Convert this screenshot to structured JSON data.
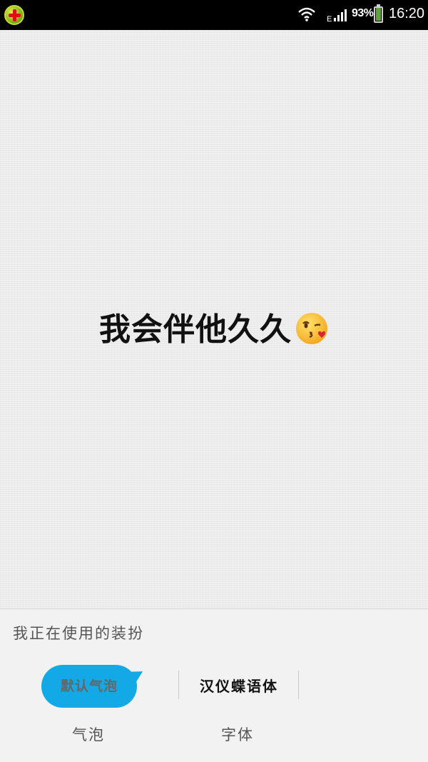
{
  "status_bar": {
    "app_icon": "app-plus-icon",
    "network": "E",
    "battery": "93%",
    "time": "16:20"
  },
  "preview": {
    "text": "我会伴他久久",
    "emoji": "kissing-face-icon"
  },
  "panel": {
    "title": "我正在使用的装扮",
    "bubble_option": "默认气泡",
    "font_option": "汉仪蝶语体",
    "bubble_category": "气泡",
    "font_category": "字体"
  },
  "colors": {
    "accent": "#12a9e6",
    "panel_bg": "#f2f2f2",
    "status_bar": "#000000"
  }
}
